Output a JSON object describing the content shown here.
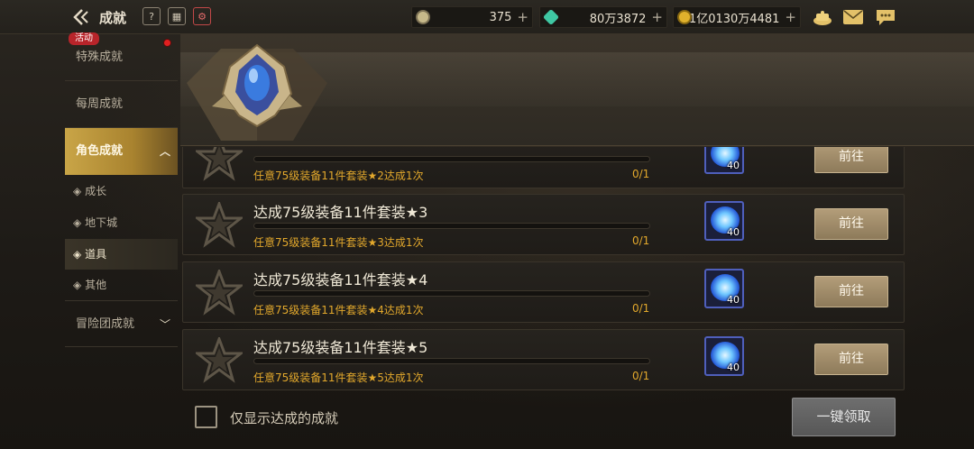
{
  "header": {
    "title": "成就",
    "tools": [
      {
        "name": "help-icon",
        "glyph": "?"
      },
      {
        "name": "calendar-icon",
        "glyph": "▦"
      },
      {
        "name": "gift-icon",
        "glyph": "⚙"
      }
    ],
    "currencies": [
      {
        "name": "coin",
        "value": "375",
        "color": "#c7b98a"
      },
      {
        "name": "gem",
        "value": "80万3872",
        "color": "#3fc7a3"
      },
      {
        "name": "gold",
        "value": "1亿0130万4481",
        "color": "#e0b12c"
      }
    ]
  },
  "sidebar": {
    "badge": "活动",
    "items": [
      {
        "label": "特殊成就"
      },
      {
        "label": "每周成就"
      },
      {
        "label": "角色成就"
      },
      {
        "label": "冒险团成就"
      }
    ],
    "subitems": [
      {
        "label": "成长"
      },
      {
        "label": "地下城"
      },
      {
        "label": "道具"
      },
      {
        "label": "其他"
      }
    ],
    "sub_prefix": "◈"
  },
  "achievements": [
    {
      "title": "",
      "desc": "任意75级装备11件套装★2达成1次",
      "count": "0/1",
      "reward_qty": "40",
      "button": "前往"
    },
    {
      "title": "达成75级装备11件套装★3",
      "desc": "任意75级装备11件套装★3达成1次",
      "count": "0/1",
      "reward_qty": "40",
      "button": "前往"
    },
    {
      "title": "达成75级装备11件套装★4",
      "desc": "任意75级装备11件套装★4达成1次",
      "count": "0/1",
      "reward_qty": "40",
      "button": "前往"
    },
    {
      "title": "达成75级装备11件套装★5",
      "desc": "任意75级装备11件套装★5达成1次",
      "count": "0/1",
      "reward_qty": "40",
      "button": "前往"
    }
  ],
  "footer": {
    "checkbox_label": "仅显示达成的成就",
    "claim_all": "一键领取"
  }
}
